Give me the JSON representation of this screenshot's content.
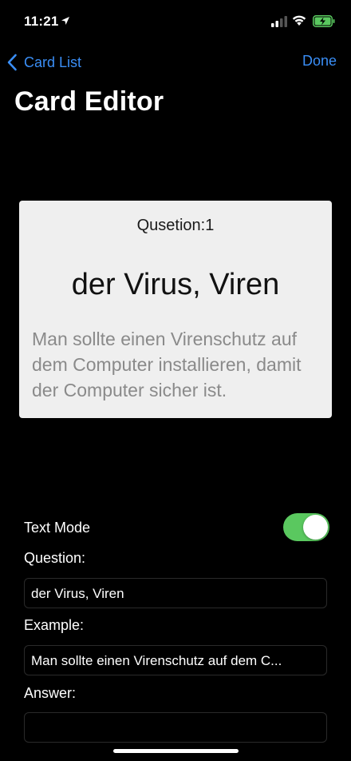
{
  "status_bar": {
    "time": "11:21",
    "icons": [
      "location-arrow-icon",
      "cellular-signal-icon",
      "wifi-icon",
      "battery-charging-icon"
    ]
  },
  "nav": {
    "back_label": "Card List",
    "done_label": "Done",
    "title": "Card Editor"
  },
  "card": {
    "number_label": "Qusetion:1",
    "question": "der Virus, Viren",
    "example": "Man sollte einen Virenschutz auf dem Computer installieren, damit der Computer sicher ist."
  },
  "form": {
    "text_mode_label": "Text Mode",
    "text_mode_on": true,
    "question_label": "Question:",
    "question_value": "der Virus, Viren",
    "example_label": "Example:",
    "example_value": "Man sollte einen Virenschutz auf dem C...",
    "answer_label": "Answer:",
    "answer_value": ""
  },
  "colors": {
    "accent": "#3a8ef6",
    "toggle_on": "#5ac85f",
    "background": "#000000",
    "card_background": "#efefef"
  }
}
